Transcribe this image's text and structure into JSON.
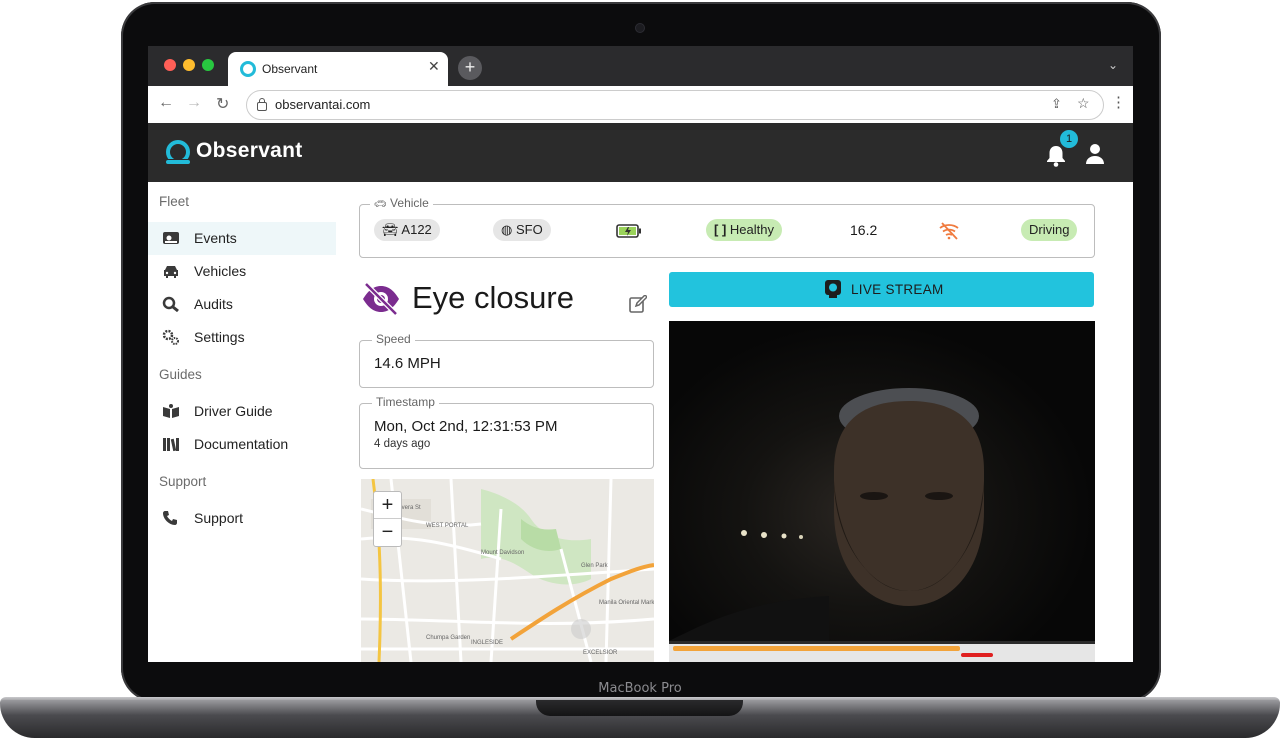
{
  "device": {
    "label": "MacBook Pro"
  },
  "browser": {
    "tab_title": "Observant",
    "url": "observantai.com"
  },
  "app": {
    "brand": "Observant",
    "notification_count": "1",
    "colors": {
      "accent": "#22bbd9",
      "appbar": "#2b2b2b",
      "status_green": "#c7ebb3"
    }
  },
  "sidebar": {
    "sections": [
      {
        "title": "Fleet",
        "items": [
          {
            "label": "Events",
            "icon": "car-front-icon"
          },
          {
            "label": "Vehicles",
            "icon": "car-icon"
          },
          {
            "label": "Audits",
            "icon": "search-user-icon"
          },
          {
            "label": "Settings",
            "icon": "gears-icon"
          }
        ]
      },
      {
        "title": "Guides",
        "items": [
          {
            "label": "Driver Guide",
            "icon": "book-open-icon"
          },
          {
            "label": "Documentation",
            "icon": "books-icon"
          }
        ]
      },
      {
        "title": "Support",
        "items": [
          {
            "label": "Support",
            "icon": "phone-icon"
          }
        ]
      }
    ]
  },
  "vehicle": {
    "legend": "Vehicle",
    "id": "A122",
    "location": "SFO",
    "camera_status": "Healthy",
    "value": "16.2",
    "state": "Driving"
  },
  "event": {
    "title": "Eye closure",
    "speed_label": "Speed",
    "speed_value": "14.6 MPH",
    "timestamp_label": "Timestamp",
    "timestamp_value": "Mon, Oct 2nd, 12:31:53 PM",
    "timestamp_relative": "4 days ago"
  },
  "live_stream_label": "LIVE STREAM",
  "map": {
    "zoom_in": "+",
    "zoom_out": "−",
    "labels": [
      "Rivera St",
      "WEST PORTAL",
      "Portola Dr",
      "Mount Davidson",
      "Glen Park",
      "Monterey Blvd",
      "Ocean Ave",
      "INGLESIDE",
      "EXCELSIOR",
      "Chumpa Garden Restaurant",
      "Manila Oriental Market",
      "San Jose Ave",
      "Diamond Heights"
    ]
  }
}
